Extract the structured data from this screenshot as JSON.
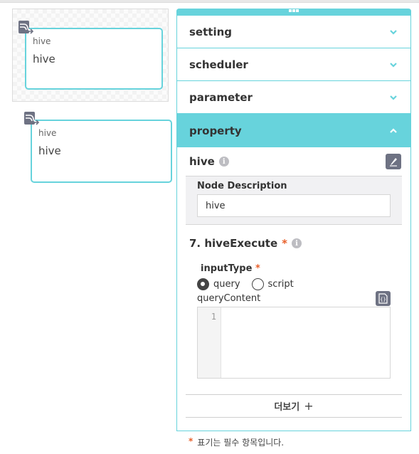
{
  "canvas": {
    "nodes": [
      {
        "type_label": "hive",
        "name": "hive",
        "icon": "hive-node-icon"
      },
      {
        "type_label": "hive",
        "name": "hive",
        "icon": "hive-node-icon"
      }
    ]
  },
  "panel": {
    "accordions": [
      {
        "label": "setting",
        "icon": "chevron-down-icon",
        "expanded": false
      },
      {
        "label": "scheduler",
        "icon": "chevron-down-icon",
        "expanded": false
      },
      {
        "label": "parameter",
        "icon": "chevron-down-icon",
        "expanded": false
      },
      {
        "label": "property",
        "icon": "chevron-up-icon",
        "expanded": true
      }
    ],
    "property": {
      "title": "hive",
      "info_icon": "i",
      "node_description": {
        "label": "Node Description",
        "value": "hive"
      },
      "execute": {
        "title": "7. hiveExecute",
        "required_mark": "*",
        "input_type": {
          "label": "inputType",
          "required_mark": "*",
          "options": [
            "query",
            "script"
          ],
          "selected": "query"
        },
        "query_content": {
          "label": "queryContent",
          "line_numbers": [
            "1"
          ],
          "value": ""
        }
      },
      "more_label": "더보기",
      "more_icon": "+"
    }
  },
  "footnote": {
    "mark": "*",
    "text": "표기는 필수 항목입니다."
  },
  "colors": {
    "accent": "#67d3dc",
    "required": "#e8612c",
    "icon_bg": "#6e7283"
  }
}
